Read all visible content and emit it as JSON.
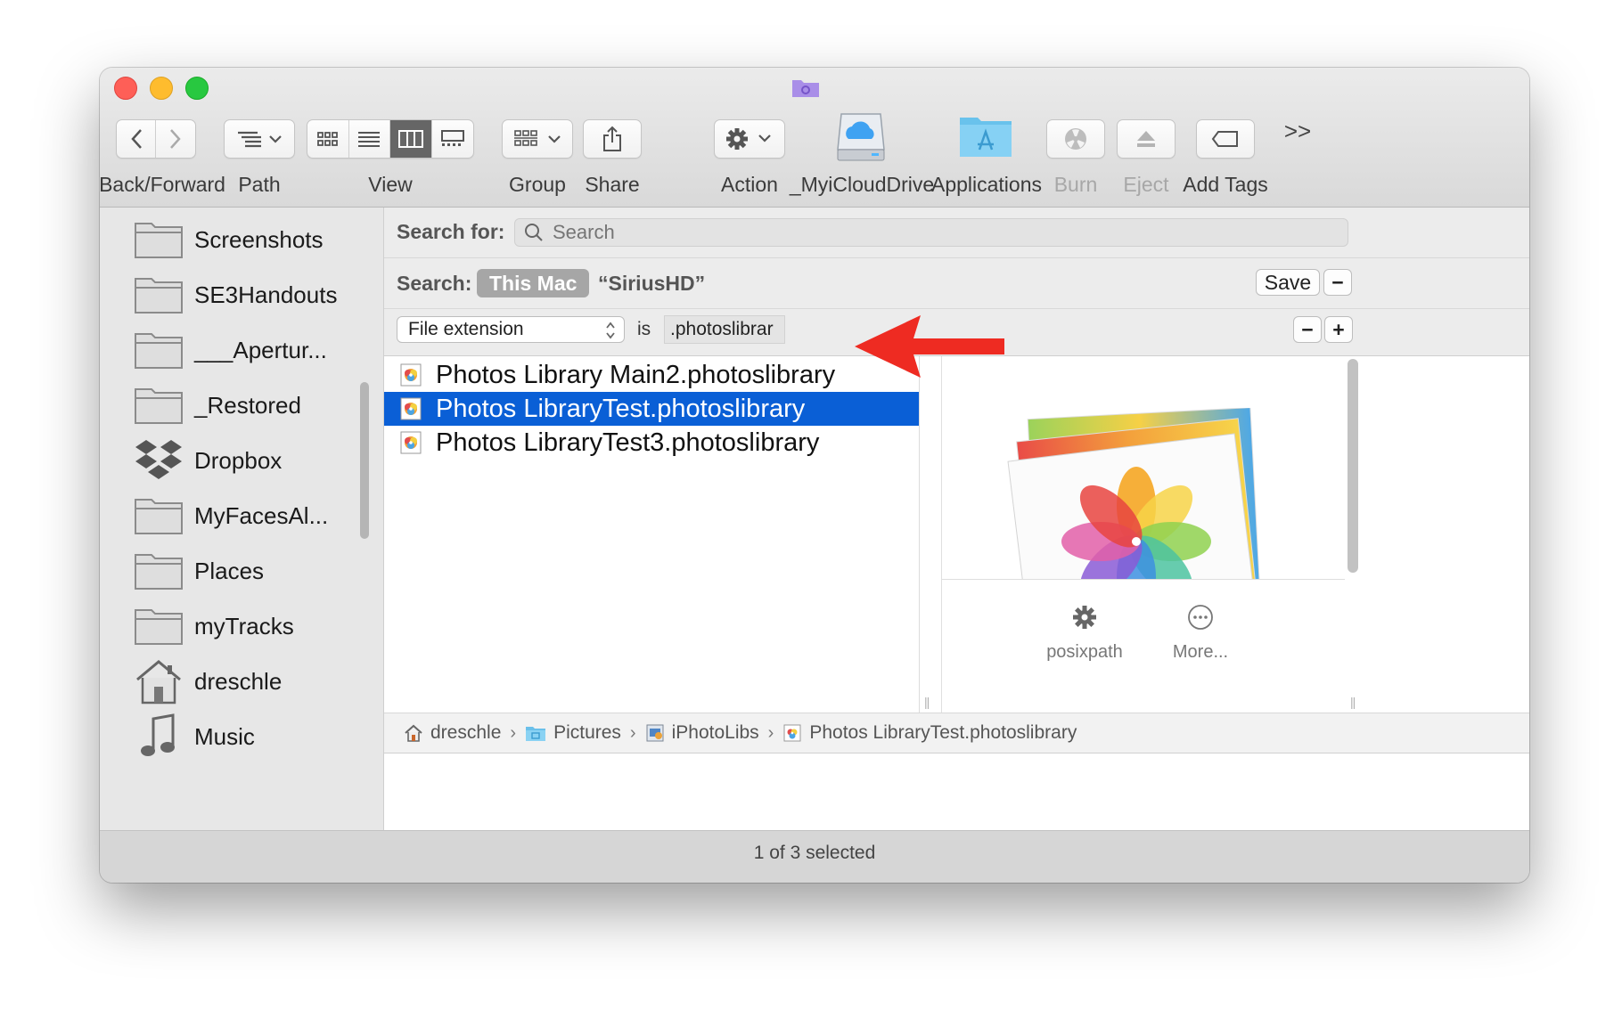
{
  "toolbar": {
    "items": [
      {
        "label": "Back/Forward"
      },
      {
        "label": "Path"
      },
      {
        "label": "View"
      },
      {
        "label": "Group"
      },
      {
        "label": "Share"
      },
      {
        "label": "Action"
      },
      {
        "label": "_MyiCloudDrive"
      },
      {
        "label": "Applications"
      },
      {
        "label": "Burn"
      },
      {
        "label": "Eject"
      },
      {
        "label": "Add Tags"
      }
    ],
    "overflow": ">>"
  },
  "sidebar": {
    "items": [
      {
        "label": "Screenshots",
        "icon": "folder-icon"
      },
      {
        "label": "SE3Handouts",
        "icon": "folder-icon"
      },
      {
        "label": "___Apertur...",
        "icon": "folder-icon"
      },
      {
        "label": "_Restored",
        "icon": "folder-icon"
      },
      {
        "label": "Dropbox",
        "icon": "dropbox-icon"
      },
      {
        "label": "MyFacesAl...",
        "icon": "folder-icon"
      },
      {
        "label": "Places",
        "icon": "folder-icon"
      },
      {
        "label": "myTracks",
        "icon": "folder-icon"
      },
      {
        "label": "dreschle",
        "icon": "home-icon"
      },
      {
        "label": "Music",
        "icon": "music-icon"
      }
    ]
  },
  "search": {
    "label": "Search for:",
    "placeholder": "Search"
  },
  "scope": {
    "label": "Search:",
    "this_mac": "This Mac",
    "volume": "“SiriusHD”",
    "save": "Save",
    "remove": "−"
  },
  "criteria": {
    "attribute": "File extension",
    "operator": "is",
    "value": ".photoslibrar",
    "remove": "−",
    "add": "+"
  },
  "files": [
    {
      "name": "Photos Library Main2.photoslibrary",
      "selected": false
    },
    {
      "name": "Photos LibraryTest.photoslibrary",
      "selected": true
    },
    {
      "name": "Photos LibraryTest3.photoslibrary",
      "selected": false
    }
  ],
  "preview": {
    "actions": [
      {
        "label": "posixpath",
        "icon": "gear-icon"
      },
      {
        "label": "More...",
        "icon": "more-icon"
      }
    ]
  },
  "pathbar": {
    "crumbs": [
      {
        "label": "dreschle",
        "icon": "home-icon"
      },
      {
        "label": "Pictures",
        "icon": "pictures-folder-icon"
      },
      {
        "label": "iPhotoLibs",
        "icon": "iphoto-icon"
      },
      {
        "label": "Photos LibraryTest.photoslibrary",
        "icon": "photos-library-icon"
      }
    ]
  },
  "status": {
    "text": "1 of 3 selected"
  },
  "colors": {
    "selection": "#0a5fd6",
    "annotation_arrow": "#ee2b22",
    "close": "#fe5f57",
    "minimize": "#febc2e",
    "zoom": "#28c840"
  }
}
